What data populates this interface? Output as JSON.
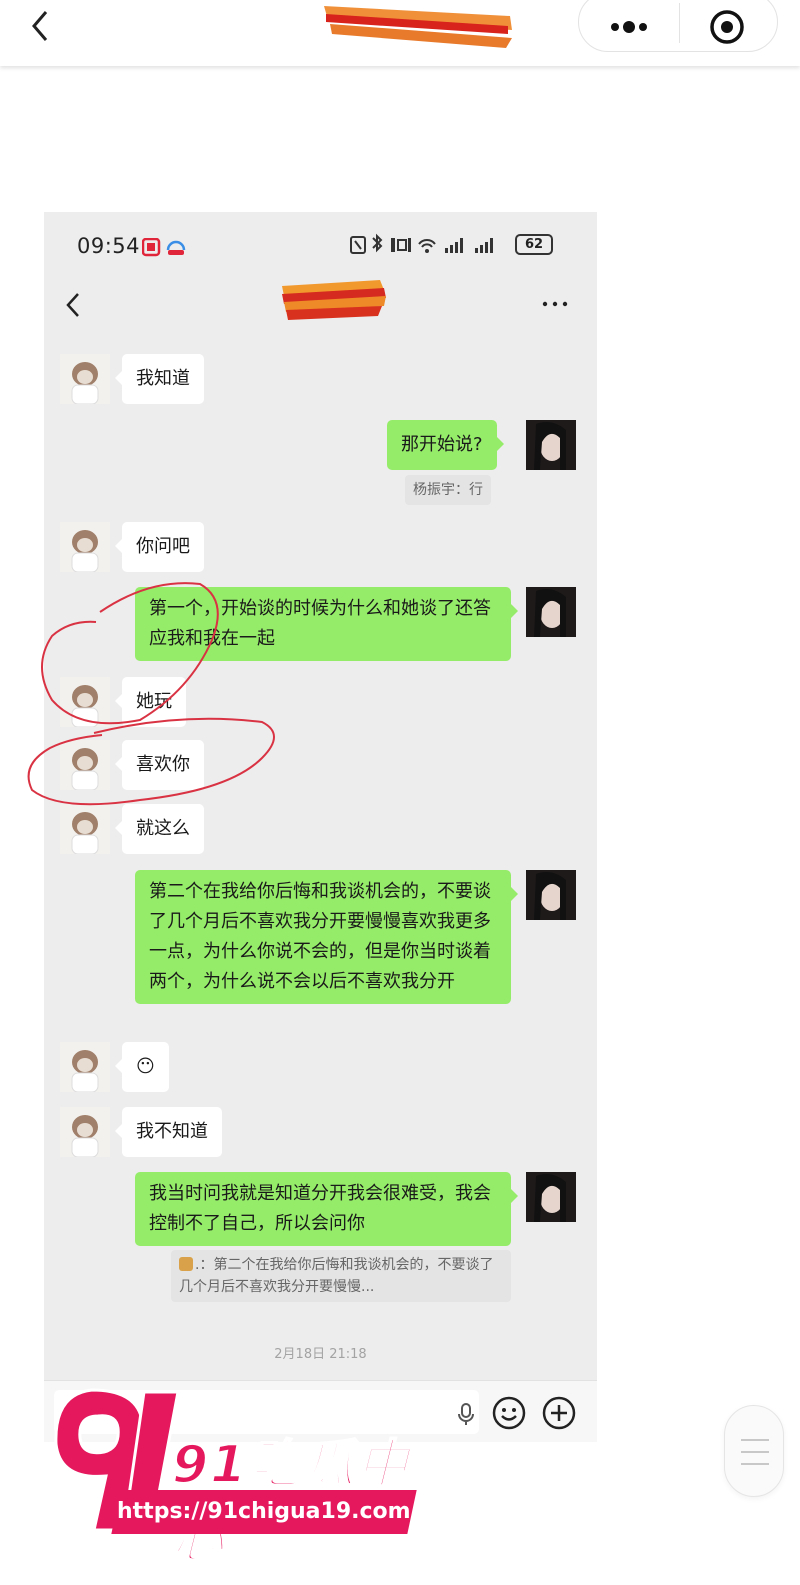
{
  "status_bar": {
    "time": "09:54",
    "battery": "62"
  },
  "messages": [
    {
      "side": "left",
      "text": "我知道"
    },
    {
      "side": "right",
      "text": "那开始说?"
    },
    {
      "side": "right",
      "text": "第一个，开始谈的时候为什么和她谈了还答应我和我在一起"
    },
    {
      "side": "left",
      "text": "你问吧"
    },
    {
      "side": "left",
      "text": "她玩"
    },
    {
      "side": "left",
      "text": "喜欢你"
    },
    {
      "side": "left",
      "text": "就这么"
    },
    {
      "side": "right",
      "text": "第二个在我给你后悔和我谈机会的，不要谈了几个月后不喜欢我分开要慢慢喜欢我更多一点，为什么你说不会的，但是你当时谈着两个，为什么说不会以后不喜欢我分开"
    },
    {
      "side": "left",
      "text": "😶"
    },
    {
      "side": "left",
      "text": "我不知道"
    },
    {
      "side": "right",
      "text": "我当时问我就是知道分开我会很难受，我会控制不了自己，所以会问你"
    }
  ],
  "quotes": {
    "q1": "杨振宇：行",
    "q2": ".：第二个在我给你后悔和我谈机会的，不要谈了几个月后不喜欢我分开要慢慢..."
  },
  "timestamp": "2月18日 21:18",
  "watermark": {
    "brand": "91吃瓜中心",
    "url": "https://91chigua19.com"
  },
  "colors": {
    "my_bubble": "#95ec69",
    "their_bubble": "#ffffff",
    "chat_background": "#ededed",
    "annotation_red": "#d93343",
    "watermark_pink": "#e5185d"
  },
  "icons": [
    "back-icon",
    "more-icon",
    "close-target-icon",
    "microphone-icon",
    "emoji-icon",
    "plus-icon"
  ]
}
